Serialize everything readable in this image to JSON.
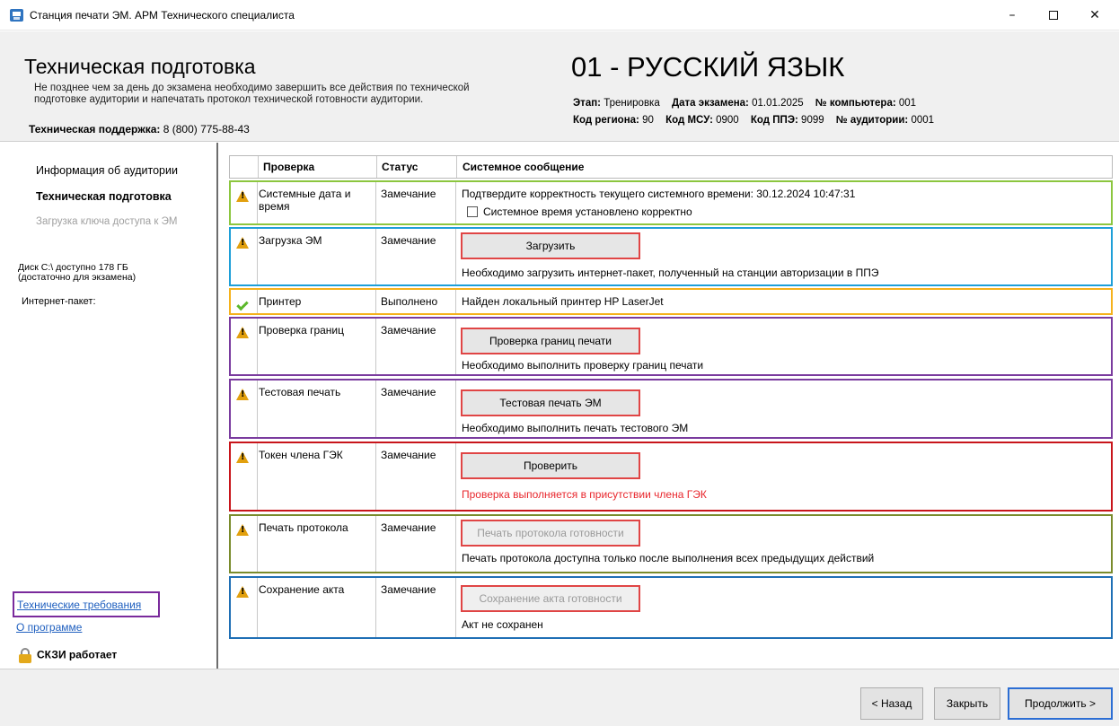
{
  "window": {
    "title": "Станция печати ЭМ. АРМ Технического специалиста",
    "controls": {
      "minimize": "–",
      "close": "✕"
    }
  },
  "header": {
    "title": "Техническая подготовка",
    "description_line1": "Не позднее чем за день до экзамена необходимо завершить все действия по технической",
    "description_line2": "подготовке аудитории и напечатать протокол технической готовности аудитории.",
    "support_label": "Техническая поддержка:",
    "support_phone": "8 (800) 775-88-43",
    "subject": "01 - РУССКИЙ ЯЗЫК",
    "stage_label": "Этап:",
    "stage_value": "Тренировка",
    "exam_date_label": "Дата экзамена:",
    "exam_date_value": "01.01.2025",
    "computer_label": "№ компьютера:",
    "computer_value": "001",
    "region_label": "Код региона:",
    "region_value": "90",
    "msu_label": "Код МСУ:",
    "msu_value": "0900",
    "ppe_label": "Код ППЭ:",
    "ppe_value": "9099",
    "room_label": "№ аудитории:",
    "room_value": "0001"
  },
  "sidebar": {
    "items": [
      {
        "label": "Информация об аудитории"
      },
      {
        "label": "Техническая подготовка"
      },
      {
        "label": "Загрузка ключа доступа к ЭМ"
      }
    ],
    "disk_line1": "Диск C:\\ доступно 178 ГБ",
    "disk_line2": "(достаточно для экзамена)",
    "internet_package": "Интернет-пакет:",
    "tech_requirements_link": "Технические требования",
    "about_link": "О программе",
    "skzi_status": "СКЗИ работает"
  },
  "table": {
    "headers": {
      "check": "Проверка",
      "status": "Статус",
      "message": "Системное сообщение"
    },
    "rows": [
      {
        "name": "Системные дата и время",
        "status": "Замечание",
        "message": "Подтвердите корректность текущего системного времени: 30.12.2024 10:47:31",
        "checkbox_label": "Системное время установлено корректно"
      },
      {
        "name": "Загрузка ЭМ",
        "status": "Замечание",
        "button": "Загрузить",
        "message": "Необходимо загрузить интернет-пакет, полученный на станции авторизации в ППЭ"
      },
      {
        "name": "Принтер",
        "status": "Выполнено",
        "message": "Найден локальный принтер HP LaserJet"
      },
      {
        "name": "Проверка границ",
        "status": "Замечание",
        "button": "Проверка границ печати",
        "message": "Необходимо выполнить проверку границ печати"
      },
      {
        "name": "Тестовая печать",
        "status": "Замечание",
        "button": "Тестовая печать ЭМ",
        "message": "Необходимо выполнить печать тестового ЭМ"
      },
      {
        "name": "Токен члена ГЭК",
        "status": "Замечание",
        "button": "Проверить",
        "message": "Проверка выполняется в присутствии члена ГЭК"
      },
      {
        "name": "Печать протокола",
        "status": "Замечание",
        "button": "Печать протокола готовности",
        "message": "Печать протокола доступна только после выполнения всех предыдущих действий"
      },
      {
        "name": "Сохранение акта",
        "status": "Замечание",
        "button": "Сохранение акта готовности",
        "message": "Акт не сохранен"
      }
    ]
  },
  "footer": {
    "back": "< Назад",
    "close": "Закрыть",
    "next": "Продолжить >"
  },
  "colors": {
    "row_border_system_time": "#8cc63f",
    "row_border_load": "#1e9fd8",
    "row_border_printer": "#f5b21c",
    "row_border_bounds": "#7a3b9e",
    "row_border_test_print": "#7a3b9e",
    "row_border_token": "#c8151b",
    "row_border_protocol": "#7a8b2c",
    "row_border_act": "#1f6fb5",
    "warning_icon": "#e2a00e",
    "ok_icon": "#5cb82b",
    "warning_text": "#e8262c"
  }
}
